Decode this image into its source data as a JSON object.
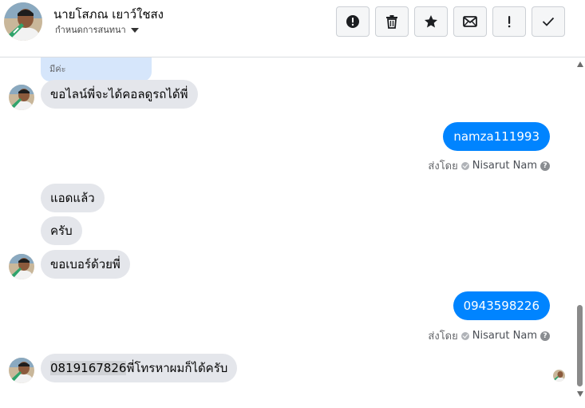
{
  "header": {
    "contact_name": "นายโสภณ เยาว์ใชสง",
    "manage_label": "กำหนดการสนทนา"
  },
  "toolbar": [
    {
      "name": "report-button",
      "icon": "exclamation-circle-icon"
    },
    {
      "name": "delete-button",
      "icon": "trash-icon"
    },
    {
      "name": "star-button",
      "icon": "star-icon"
    },
    {
      "name": "unread-button",
      "icon": "envelope-icon"
    },
    {
      "name": "important-button",
      "icon": "exclamation-icon"
    },
    {
      "name": "done-button",
      "icon": "check-icon"
    }
  ],
  "messages": {
    "partial_text": "มีค่ะ",
    "in_1": "ขอไลน์พี่จะได้คอลดูรถได้พี่",
    "out_1": "namza111993",
    "sent_by_label": "ส่งโดย",
    "sender_name": "Nisarut Nam",
    "in_2": "แอดแล้ว",
    "in_3": "ครับ",
    "in_4": "ขอเบอร์ด้วยพี่",
    "out_2": "0943598226",
    "in_5_phone": "0819167826",
    "in_5_rest": "พี่โทรหาผมก็ได้ครับ"
  },
  "colors": {
    "outgoing_bubble": "#0084ff",
    "incoming_bubble": "#e4e6eb"
  }
}
